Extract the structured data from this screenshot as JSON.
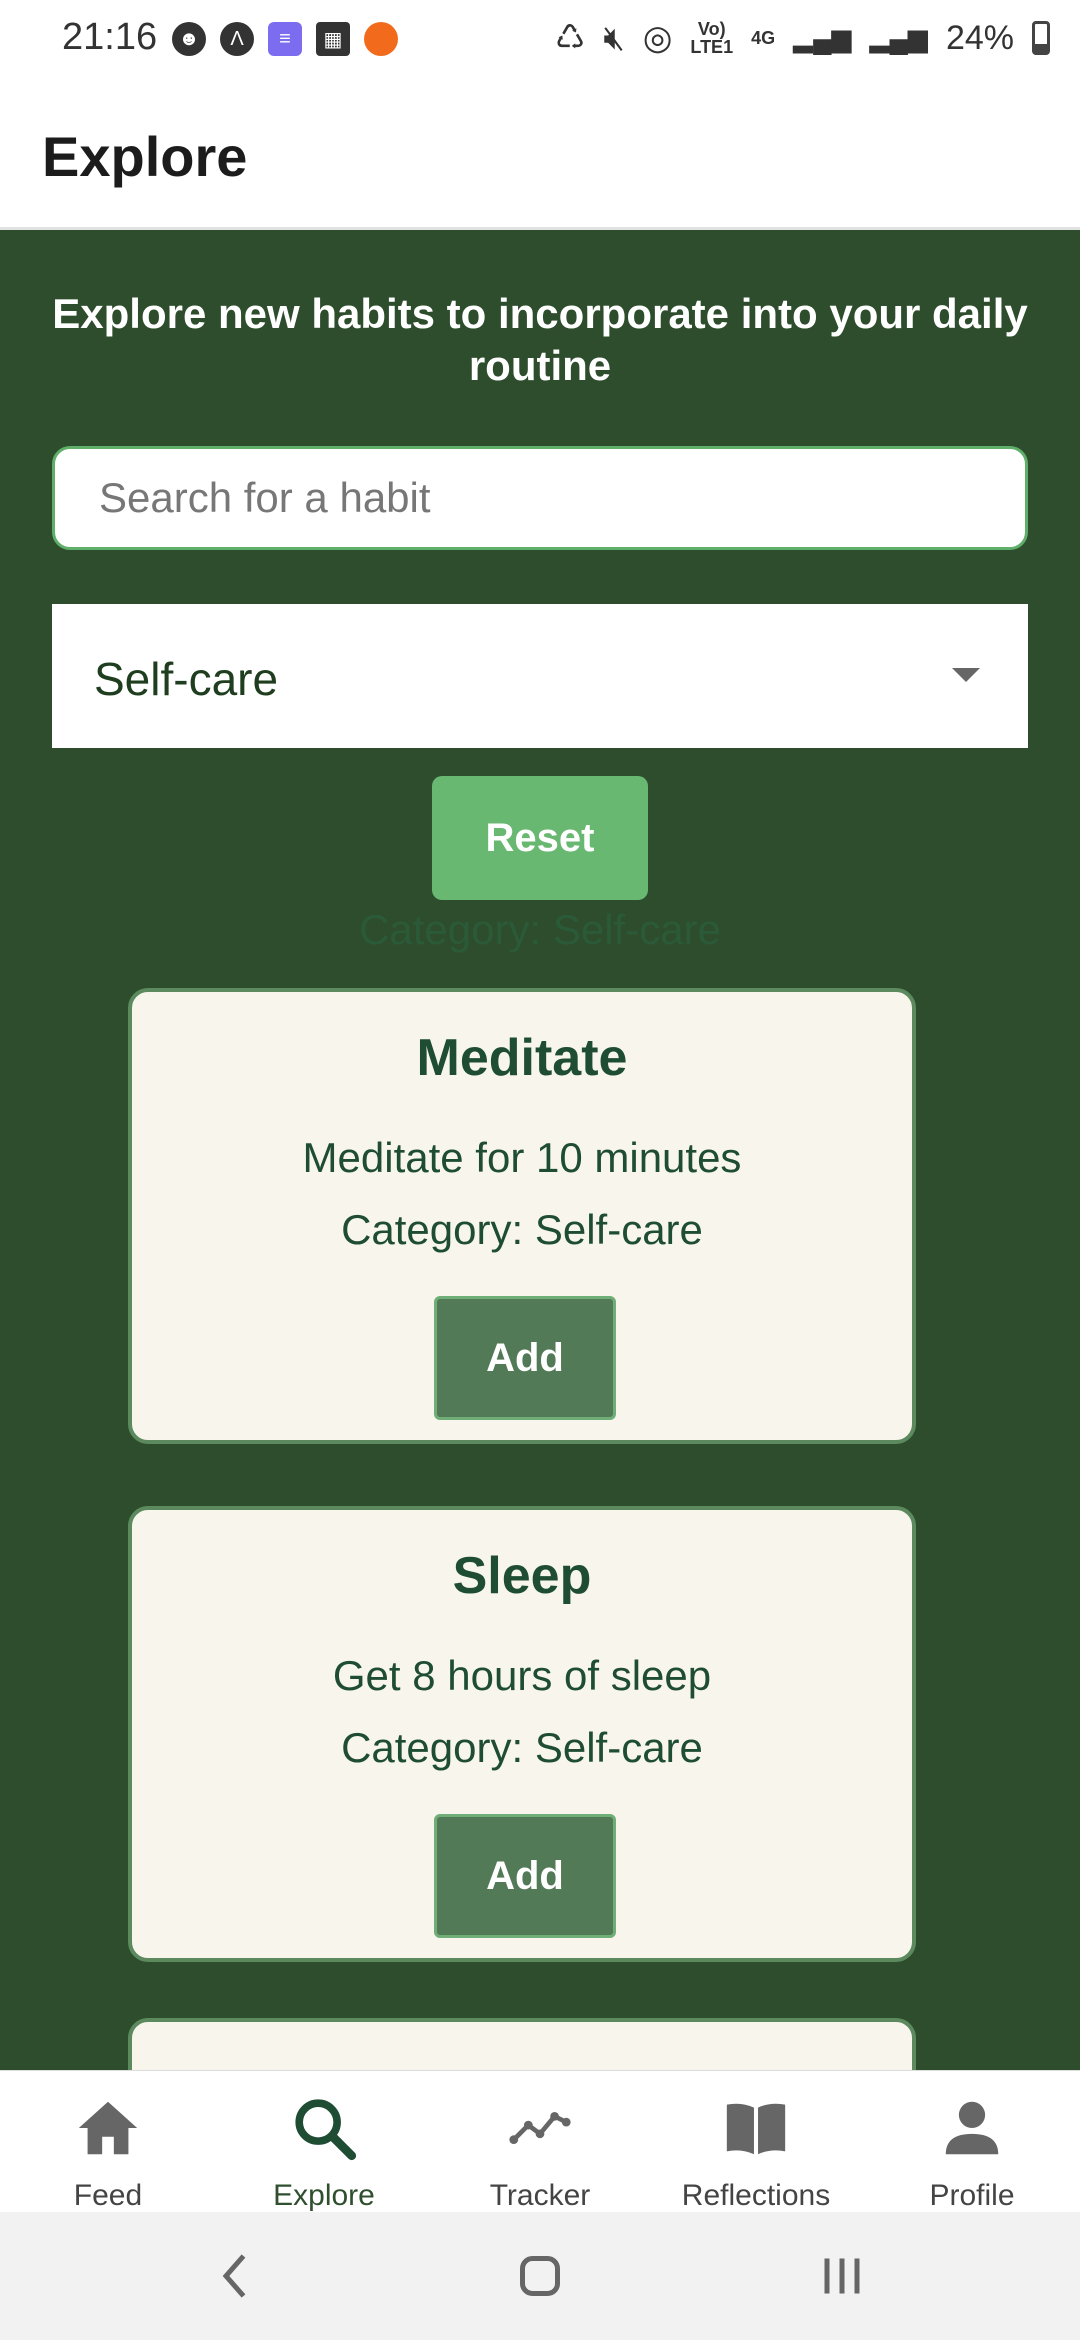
{
  "status_bar": {
    "time": "21:16",
    "network_label_top": "Vo)",
    "network_label_bottom": "LTE1",
    "data_label": "4G",
    "battery": "24%"
  },
  "header": {
    "title": "Explore"
  },
  "intro": "Explore new habits to incorporate into your daily routine",
  "search": {
    "placeholder": "Search for a habit",
    "value": ""
  },
  "category_select": {
    "selected": "Self-care"
  },
  "reset_label": "Reset",
  "category_label": "Category: Self-care",
  "habits": [
    {
      "title": "Meditate",
      "description": "Meditate for 10 minutes",
      "category": "Category: Self-care",
      "add_label": "Add"
    },
    {
      "title": "Sleep",
      "description": "Get 8 hours of sleep",
      "category": "Category: Self-care",
      "add_label": "Add"
    }
  ],
  "nav": [
    {
      "label": "Feed",
      "icon": "home-icon"
    },
    {
      "label": "Explore",
      "icon": "search-icon"
    },
    {
      "label": "Tracker",
      "icon": "trend-icon"
    },
    {
      "label": "Reflections",
      "icon": "book-icon"
    },
    {
      "label": "Profile",
      "icon": "person-icon"
    }
  ],
  "colors": {
    "background": "#2d4d2c",
    "accent": "#68b872",
    "card": "#f8f6ec",
    "active_nav": "#1e4d34"
  }
}
